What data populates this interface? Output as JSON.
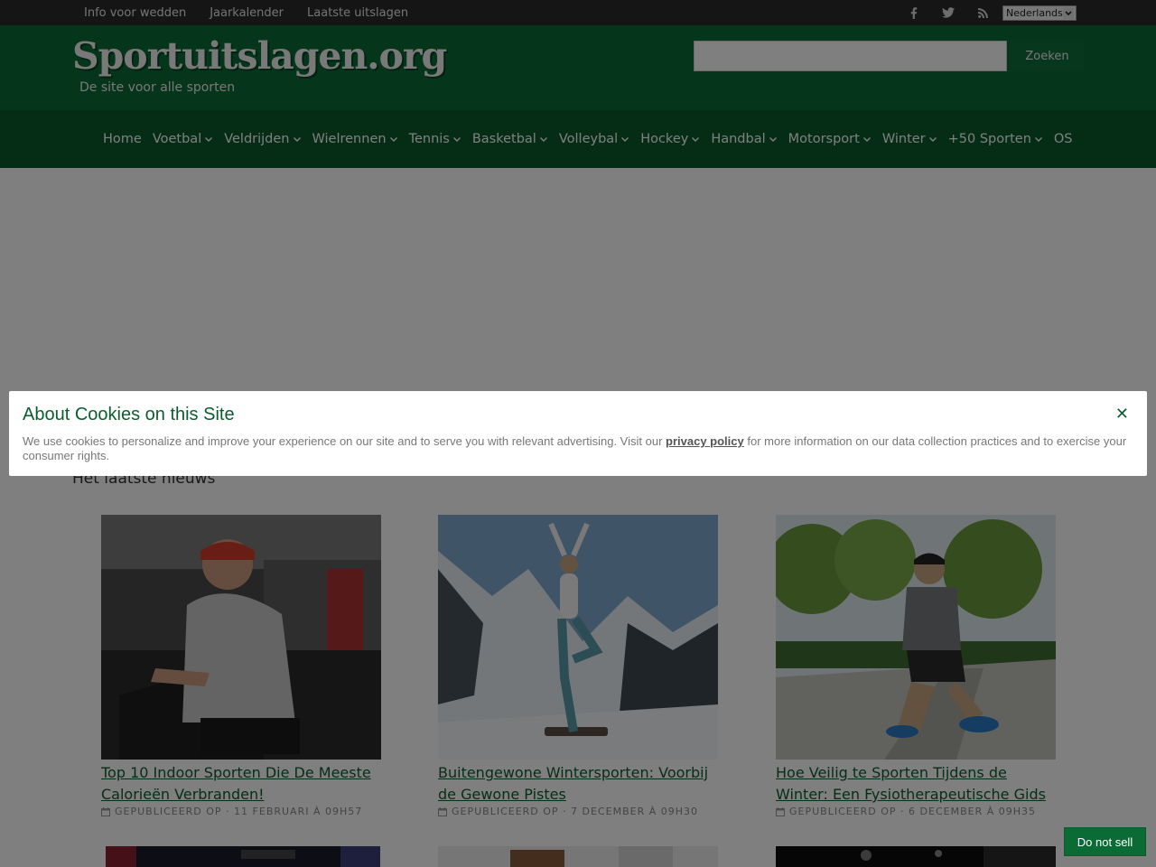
{
  "topbar": {
    "links": [
      "Info voor wedden",
      "Jaarkalender",
      "Laatste uitslagen"
    ],
    "social_icons": [
      "facebook-icon",
      "twitter-icon",
      "rss-icon"
    ],
    "language": "Nederlands"
  },
  "header": {
    "logo": "Sportuitslagen.org",
    "tagline": "De site voor alle sporten",
    "search_placeholder": "",
    "search_button": "Zoeken"
  },
  "nav": {
    "items": [
      {
        "label": "Home",
        "dropdown": false
      },
      {
        "label": "Voetbal",
        "dropdown": true
      },
      {
        "label": "Veldrijden",
        "dropdown": true
      },
      {
        "label": "Wielrennen",
        "dropdown": true
      },
      {
        "label": "Tennis",
        "dropdown": true
      },
      {
        "label": "Basketbal",
        "dropdown": true
      },
      {
        "label": "Volleybal",
        "dropdown": true
      },
      {
        "label": "Hockey",
        "dropdown": true
      },
      {
        "label": "Handbal",
        "dropdown": true
      },
      {
        "label": "Motorsport",
        "dropdown": true
      },
      {
        "label": "Winter",
        "dropdown": true
      },
      {
        "label": "+50 Sporten",
        "dropdown": true
      },
      {
        "label": "OS",
        "dropdown": false
      }
    ]
  },
  "main": {
    "section_title": "Het laatste nieuws",
    "articles": [
      {
        "title": "Top 10 Indoor Sporten Die De Meeste Calorieën Verbranden!",
        "meta": "Gepubliceerd op · 11 februari à 09h57"
      },
      {
        "title": "Buitengewone Wintersporten: Voorbij de Gewone Pistes",
        "meta": "Gepubliceerd op · 7 december à 09h30"
      },
      {
        "title": "Hoe Veilig te Sporten Tijdens de Winter: Een Fysiotherapeutische Gids",
        "meta": "Gepubliceerd op · 6 december à 09h35"
      }
    ]
  },
  "cookie": {
    "title": "About Cookies on this Site",
    "text_before": "We use cookies to personalize and improve your experience on our site and to serve you with relevant advertising. Visit our ",
    "link": "privacy policy",
    "text_after": " for more information on our data collection practices and to exercise your consumer rights.",
    "close": "✕"
  },
  "do_not_sell": "Do not sell",
  "colors": {
    "header_green": "#0a6b35",
    "nav_green": "#0a5a2c",
    "link_green": "#0b5d2f",
    "topbar": "#2b2b2b"
  }
}
